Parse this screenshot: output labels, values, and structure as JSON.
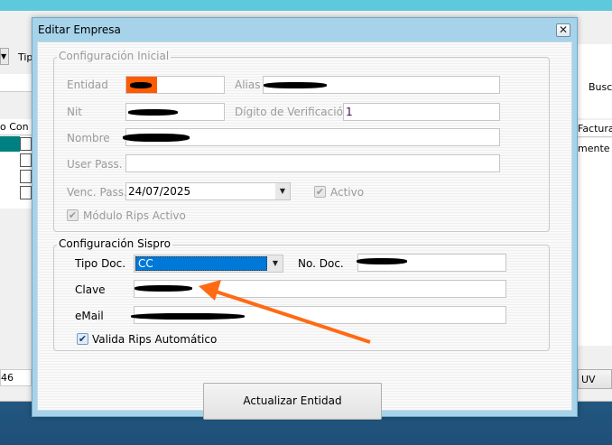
{
  "background_app": {
    "tipo_partial": "Tip",
    "col_header_partial": "o Con E",
    "busca_partial": "Busca",
    "factura_partial": "Factura",
    "mente_partial": "mente",
    "field_partial": "46",
    "uv_partial": "UV"
  },
  "dialog": {
    "title": "Editar Empresa",
    "close_icon": "close-icon",
    "config_inicial": {
      "legend": "Configuración Inicial",
      "entidad_label": "Entidad",
      "alias_label": "Alias",
      "nit_label": "Nit",
      "digito_label": "Dígito de Verificación",
      "digito_value": "1",
      "nombre_label": "Nombre",
      "user_pass_label": "User Pass.",
      "user_pass_value": "",
      "venc_pass_label": "Venc. Pass.",
      "venc_pass_value": "24/07/2025",
      "activo_label": "Activo",
      "activo_checked": true,
      "modulo_rips_label": "Módulo Rips Activo",
      "modulo_rips_checked": true
    },
    "config_sispro": {
      "legend": "Configuración Sispro",
      "tipo_doc_label": "Tipo Doc.",
      "tipo_doc_value": "CC",
      "no_doc_label": "No. Doc.",
      "clave_label": "Clave",
      "email_label": "eMail",
      "valida_rips_label": "Valida Rips Automático",
      "valida_rips_checked": true
    },
    "update_button": "Actualizar Entidad"
  },
  "colors": {
    "selection": "#0078d7",
    "annotation_arrow": "#ff6a13",
    "highlight": "#ff5a00"
  }
}
